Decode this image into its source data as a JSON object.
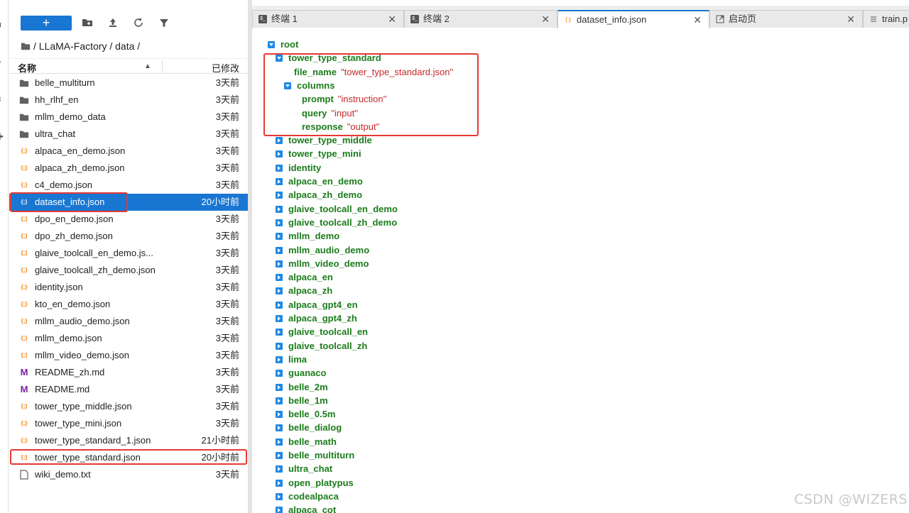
{
  "browser": {
    "breadcrumb": "/ LLaMA-Factory / data /",
    "col_name": "名称",
    "col_modified": "已修改",
    "files": [
      {
        "name": "belle_multiturn",
        "type": "folder",
        "modified": "3天前"
      },
      {
        "name": "hh_rlhf_en",
        "type": "folder",
        "modified": "3天前"
      },
      {
        "name": "mllm_demo_data",
        "type": "folder",
        "modified": "3天前"
      },
      {
        "name": "ultra_chat",
        "type": "folder",
        "modified": "3天前"
      },
      {
        "name": "alpaca_en_demo.json",
        "type": "json",
        "modified": "3天前"
      },
      {
        "name": "alpaca_zh_demo.json",
        "type": "json",
        "modified": "3天前"
      },
      {
        "name": "c4_demo.json",
        "type": "json",
        "modified": "3天前"
      },
      {
        "name": "dataset_info.json",
        "type": "json",
        "modified": "20小时前",
        "selected": true,
        "highlighted": true
      },
      {
        "name": "dpo_en_demo.json",
        "type": "json",
        "modified": "3天前"
      },
      {
        "name": "dpo_zh_demo.json",
        "type": "json",
        "modified": "3天前"
      },
      {
        "name": "glaive_toolcall_en_demo.js...",
        "type": "json",
        "modified": "3天前"
      },
      {
        "name": "glaive_toolcall_zh_demo.json",
        "type": "json",
        "modified": "3天前"
      },
      {
        "name": "identity.json",
        "type": "json",
        "modified": "3天前"
      },
      {
        "name": "kto_en_demo.json",
        "type": "json",
        "modified": "3天前"
      },
      {
        "name": "mllm_audio_demo.json",
        "type": "json",
        "modified": "3天前"
      },
      {
        "name": "mllm_demo.json",
        "type": "json",
        "modified": "3天前"
      },
      {
        "name": "mllm_video_demo.json",
        "type": "json",
        "modified": "3天前"
      },
      {
        "name": "README_zh.md",
        "type": "md",
        "modified": "3天前"
      },
      {
        "name": "README.md",
        "type": "md",
        "modified": "3天前"
      },
      {
        "name": "tower_type_middle.json",
        "type": "json",
        "modified": "3天前"
      },
      {
        "name": "tower_type_mini.json",
        "type": "json",
        "modified": "3天前"
      },
      {
        "name": "tower_type_standard_1.json",
        "type": "json",
        "modified": "21小时前"
      },
      {
        "name": "tower_type_standard.json",
        "type": "json",
        "modified": "20小时前",
        "highlighted": true
      },
      {
        "name": "wiki_demo.txt",
        "type": "txt",
        "modified": "3天前"
      }
    ]
  },
  "tabs": [
    {
      "label": "终端 1",
      "icon": "terminal-icon",
      "active": false
    },
    {
      "label": "终端 2",
      "icon": "terminal-icon",
      "active": false
    },
    {
      "label": "dataset_info.json",
      "icon": "json-icon",
      "active": true
    },
    {
      "label": "启动页",
      "icon": "launcher-icon",
      "active": false
    },
    {
      "label": "train.p",
      "icon": "file-icon",
      "active": false
    }
  ],
  "tree": {
    "root_label": "root",
    "expanded": {
      "key": "tower_type_standard",
      "file_name_key": "file_name",
      "file_name_value": "\"tower_type_standard.json\"",
      "columns_key": "columns",
      "columns": [
        {
          "key": "prompt",
          "value": "\"instruction\""
        },
        {
          "key": "query",
          "value": "\"input\""
        },
        {
          "key": "response",
          "value": "\"output\""
        }
      ]
    },
    "collapsed_keys": [
      "tower_type_middle",
      "tower_type_mini",
      "identity",
      "alpaca_en_demo",
      "alpaca_zh_demo",
      "glaive_toolcall_en_demo",
      "glaive_toolcall_zh_demo",
      "mllm_demo",
      "mllm_audio_demo",
      "mllm_video_demo",
      "alpaca_en",
      "alpaca_zh",
      "alpaca_gpt4_en",
      "alpaca_gpt4_zh",
      "glaive_toolcall_en",
      "glaive_toolcall_zh",
      "lima",
      "guanaco",
      "belle_2m",
      "belle_1m",
      "belle_0.5m",
      "belle_dialog",
      "belle_math",
      "belle_multiturn",
      "ultra_chat",
      "open_platypus",
      "codealpaca",
      "alpaca_cot"
    ]
  },
  "watermark": "CSDN @WIZERS"
}
